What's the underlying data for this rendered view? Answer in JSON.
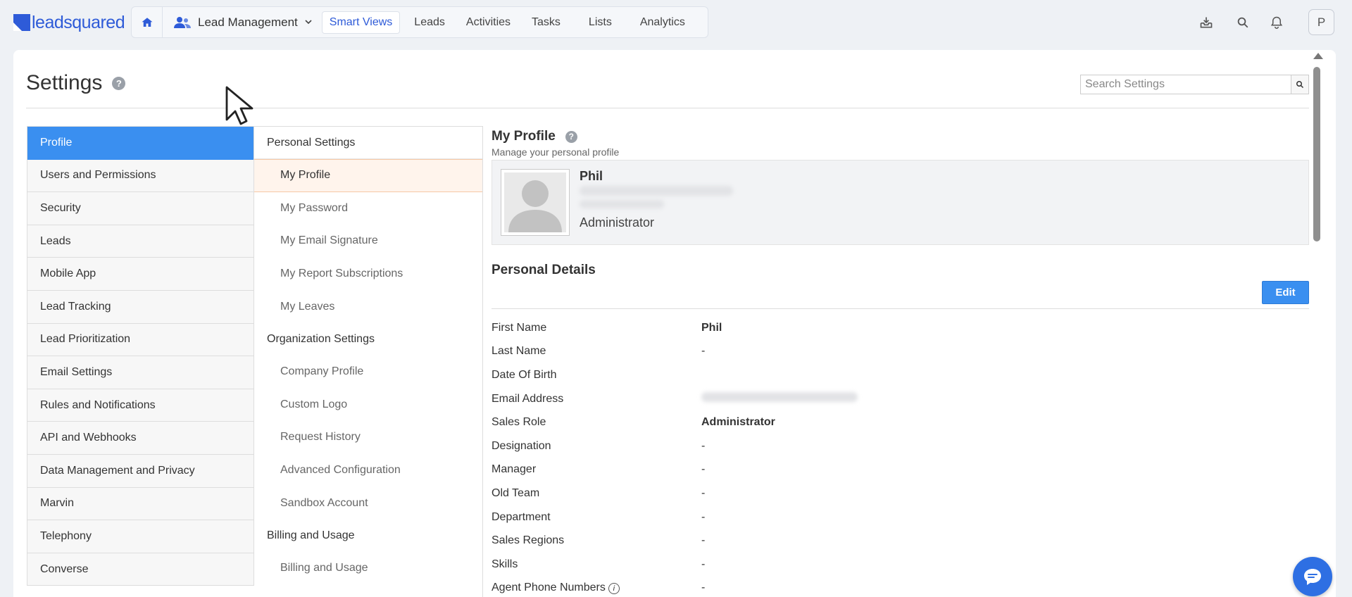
{
  "brand": {
    "logo_text": "leadsquared"
  },
  "nav": {
    "app_name": "Lead Management",
    "items": [
      "Smart Views",
      "Leads",
      "Activities",
      "Tasks",
      "Lists",
      "Analytics"
    ],
    "active_item": "Smart Views"
  },
  "user": {
    "initial": "P"
  },
  "settings": {
    "title": "Settings",
    "search_placeholder": "Search Settings"
  },
  "left_menu": {
    "items": [
      "Profile",
      "Users and Permissions",
      "Security",
      "Leads",
      "Mobile App",
      "Lead Tracking",
      "Lead Prioritization",
      "Email Settings",
      "Rules and Notifications",
      "API and Webhooks",
      "Data Management and Privacy",
      "Marvin",
      "Telephony",
      "Converse"
    ],
    "active": "Profile"
  },
  "sub_menu": {
    "personal_heading": "Personal Settings",
    "personal_items": [
      "My Profile",
      "My Password",
      "My Email Signature",
      "My Report Subscriptions",
      "My Leaves"
    ],
    "org_heading": "Organization Settings",
    "org_items": [
      "Company Profile",
      "Custom Logo",
      "Request History",
      "Advanced Configuration",
      "Sandbox Account"
    ],
    "billing_heading": "Billing and Usage",
    "billing_items": [
      "Billing and Usage"
    ]
  },
  "profile": {
    "title": "My Profile",
    "subtitle": "Manage your personal profile",
    "name": "Phil",
    "role": "Administrator"
  },
  "personal_details": {
    "title": "Personal Details",
    "edit_label": "Edit",
    "rows": [
      {
        "label": "First Name",
        "value": "Phil"
      },
      {
        "label": "Last Name",
        "value": "-"
      },
      {
        "label": "Date Of Birth",
        "value": ""
      },
      {
        "label": "Email Address",
        "value": ""
      },
      {
        "label": "Sales Role",
        "value": "Administrator"
      },
      {
        "label": "Designation",
        "value": "-"
      },
      {
        "label": "Manager",
        "value": "-"
      },
      {
        "label": "Old Team",
        "value": "-"
      },
      {
        "label": "Department",
        "value": "-"
      },
      {
        "label": "Sales Regions",
        "value": "-"
      },
      {
        "label": "Skills",
        "value": "-"
      },
      {
        "label": "Agent Phone Numbers",
        "value": "-"
      }
    ]
  },
  "colors": {
    "accent": "#3a8ff0",
    "brand": "#2e5bd8"
  }
}
